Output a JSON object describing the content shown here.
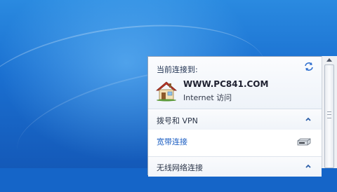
{
  "network_flyout": {
    "current_label": "当前连接到:",
    "current_network": {
      "name": "WWW.PC841.COM",
      "status": "Internet 访问",
      "icon": "home-network-icon"
    },
    "refresh_icon": "refresh-icon",
    "sections": [
      {
        "title": "拨号和 VPN",
        "expanded": true,
        "items": [
          {
            "label": "宽带连接",
            "icon": "modem-icon"
          }
        ]
      },
      {
        "title": "无线网络连接",
        "expanded": true,
        "items": []
      }
    ]
  },
  "colors": {
    "link": "#1a5dc2",
    "desktop": "#1a6fd0"
  }
}
